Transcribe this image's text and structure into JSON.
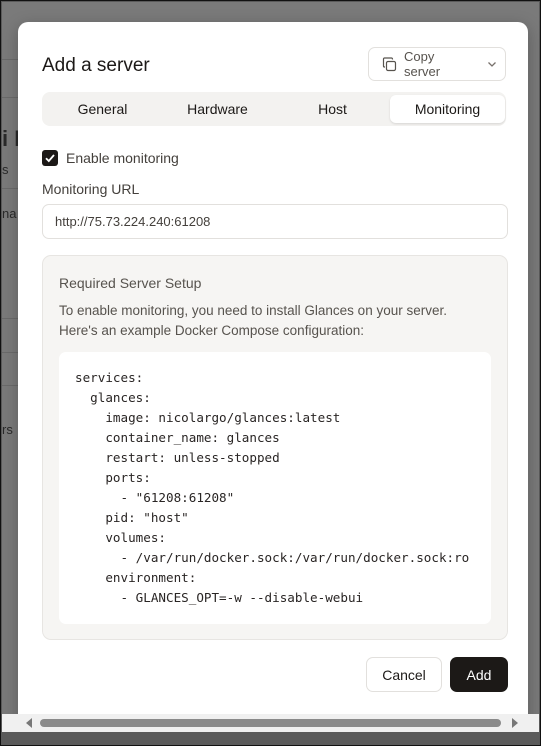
{
  "background": {
    "fragments": [
      "i I",
      "s",
      "na",
      "rs"
    ]
  },
  "modal": {
    "title": "Add a server",
    "copy_server": {
      "label": "Copy server",
      "icon": "copy-icon",
      "chevron": "chevron-down-icon"
    },
    "tabs": [
      {
        "label": "General",
        "active": false
      },
      {
        "label": "Hardware",
        "active": false
      },
      {
        "label": "Host",
        "active": false
      },
      {
        "label": "Monitoring",
        "active": true
      }
    ],
    "enable_monitoring": {
      "label": "Enable monitoring",
      "checked": true
    },
    "monitoring_url": {
      "label": "Monitoring URL",
      "value": "http://75.73.224.240:61208"
    },
    "setup": {
      "title": "Required Server Setup",
      "description": "To enable monitoring, you need to install Glances on your server. Here's an example Docker Compose configuration:",
      "code_lines": [
        "services:",
        "  glances:",
        "    image: nicolargo/glances:latest",
        "    container_name: glances",
        "    restart: unless-stopped",
        "    ports:",
        "      - \"61208:61208\"",
        "    pid: \"host\"",
        "    volumes:",
        "      - /var/run/docker.sock:/var/run/docker.sock:ro",
        "    environment:",
        "      - GLANCES_OPT=-w --disable-webui"
      ]
    },
    "buttons": {
      "cancel": "Cancel",
      "add": "Add"
    }
  },
  "colors": {
    "primary": "#1c1917",
    "muted_text": "#57534e",
    "panel_bg": "#f6f5f3"
  }
}
